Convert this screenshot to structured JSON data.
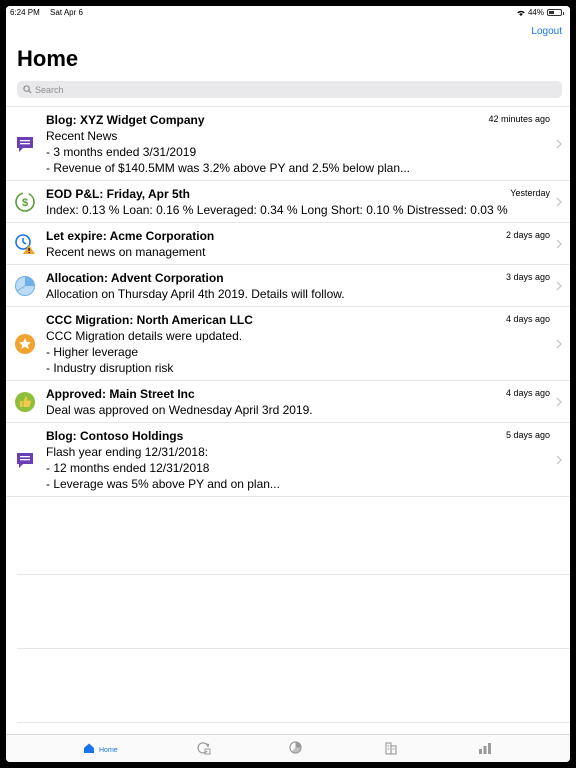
{
  "status_bar": {
    "time": "6:24 PM",
    "date": "Sat Apr 6",
    "battery": "44%",
    "battery_level": 0.44
  },
  "header": {
    "logout_label": "Logout",
    "title": "Home"
  },
  "search": {
    "placeholder": "Search"
  },
  "items": [
    {
      "icon": "chat-bubble-icon",
      "title": "Blog: XYZ Widget Company",
      "time": "42 minutes ago",
      "lines": [
        "Recent News",
        "- 3 months ended 3/31/2019",
        "- Revenue of $140.5MM was 3.2% above PY and 2.5% below plan..."
      ]
    },
    {
      "icon": "dollar-refresh-icon",
      "title": "EOD P&L: Friday, Apr 5th",
      "time": "Yesterday",
      "lines": [
        "Index: 0.13 % Loan: 0.16 % Leveraged: 0.34 % Long Short: 0.10 % Distressed: 0.03 %"
      ]
    },
    {
      "icon": "clock-warning-icon",
      "title": "Let expire: Acme Corporation",
      "time": "2 days ago",
      "lines": [
        "Recent news on management"
      ]
    },
    {
      "icon": "pie-chart-icon",
      "title": "Allocation: Advent Corporation",
      "time": "3 days ago",
      "lines": [
        "Allocation on Thursday April 4th 2019. Details will follow."
      ]
    },
    {
      "icon": "migration-badge-icon",
      "title": "CCC Migration: North American LLC",
      "time": "4 days ago",
      "lines": [
        "CCC Migration details were updated.",
        "- Higher leverage",
        "- Industry disruption risk"
      ]
    },
    {
      "icon": "thumbs-up-icon",
      "title": "Approved: Main Street Inc",
      "time": "4 days ago",
      "lines": [
        "Deal was approved on Wednesday April 3rd 2019."
      ]
    },
    {
      "icon": "chat-bubble-icon",
      "title": "Blog: Contoso Holdings",
      "time": "5 days ago",
      "lines": [
        "Flash year ending 12/31/2018:",
        "- 12 months ended 12/31/2018",
        "- Leverage was 5% above PY and on plan..."
      ]
    }
  ],
  "tabbar": {
    "tabs": [
      {
        "icon": "home-icon",
        "label": "Home",
        "active": true
      },
      {
        "icon": "refresh-doc-icon",
        "label": "",
        "active": false
      },
      {
        "icon": "pie-chart-tab-icon",
        "label": "",
        "active": false
      },
      {
        "icon": "buildings-icon",
        "label": "",
        "active": false
      },
      {
        "icon": "bar-chart-icon",
        "label": "",
        "active": false
      }
    ]
  },
  "colors": {
    "accent": "#1a73e8",
    "purple": "#6b3fb5",
    "green": "#5a9e2f",
    "orange": "#f2a22e",
    "blue_light": "#6fb0e8"
  }
}
